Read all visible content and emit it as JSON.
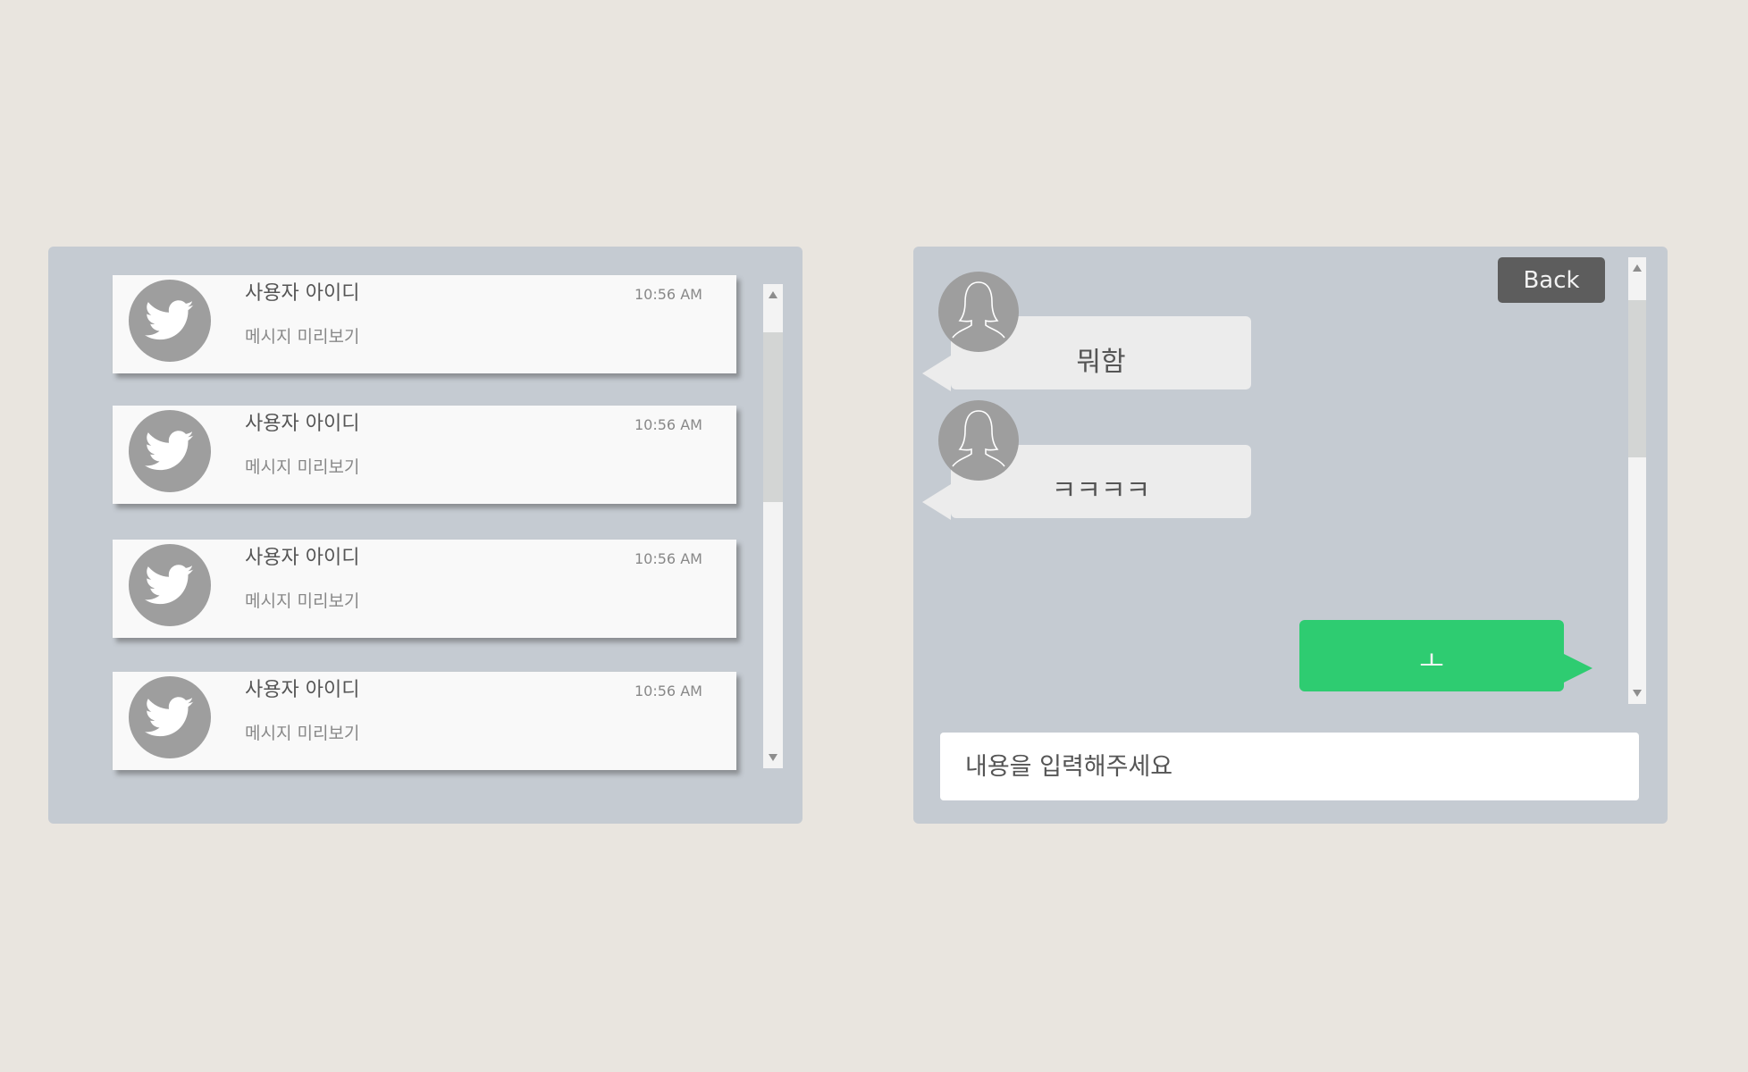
{
  "conversation_list": {
    "items": [
      {
        "user_id": "사용자 아이디",
        "preview": "메시지 미리보기",
        "time": "10:56 AM",
        "icon": "twitter-bird-icon"
      },
      {
        "user_id": "사용자 아이디",
        "preview": "메시지 미리보기",
        "time": "10:56 AM",
        "icon": "twitter-bird-icon"
      },
      {
        "user_id": "사용자 아이디",
        "preview": "메시지 미리보기",
        "time": "10:56 AM",
        "icon": "twitter-bird-icon"
      },
      {
        "user_id": "사용자 아이디",
        "preview": "메시지 미리보기",
        "time": "10:56 AM",
        "icon": "twitter-bird-icon"
      }
    ]
  },
  "chat": {
    "back_label": "Back",
    "messages": [
      {
        "direction": "incoming",
        "text": "뭐함",
        "avatar": "user-silhouette-icon"
      },
      {
        "direction": "incoming",
        "text": "ㅋㅋㅋㅋ",
        "avatar": "user-silhouette-icon"
      },
      {
        "direction": "outgoing",
        "text": "ㅗ"
      }
    ],
    "input_placeholder": "내용을 입력해주세요"
  },
  "colors": {
    "background": "#e9e5df",
    "panel": "#c5cbd2",
    "outgoing_bubble": "#2ecc71",
    "incoming_bubble": "#ececec",
    "back_button": "#5d5d5d",
    "avatar": "#9e9e9e"
  }
}
